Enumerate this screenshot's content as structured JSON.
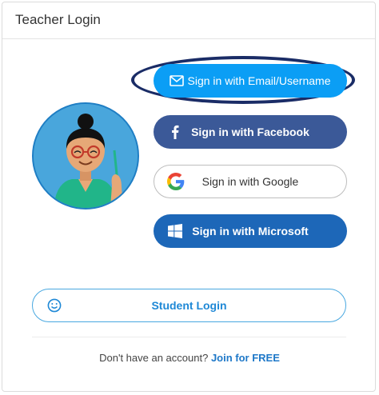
{
  "header": {
    "title": "Teacher Login"
  },
  "login_options": {
    "email": {
      "label": "Sign in with Email/Username",
      "icon": "envelope-icon"
    },
    "facebook": {
      "label": "Sign in with Facebook",
      "icon": "facebook-icon"
    },
    "google": {
      "label": "Sign in with Google",
      "icon": "google-icon"
    },
    "microsoft": {
      "label": "Sign in with Microsoft",
      "icon": "windows-icon"
    }
  },
  "student": {
    "label": "Student Login",
    "icon": "smiley-icon"
  },
  "signup": {
    "prompt": "Don't have an account?",
    "link": "Join for FREE"
  },
  "colors": {
    "email": "#0b9ef5",
    "facebook": "#3b5998",
    "microsoft": "#1d67b8",
    "student_text": "#1e88d6",
    "highlight_ring": "#1a2c66"
  }
}
